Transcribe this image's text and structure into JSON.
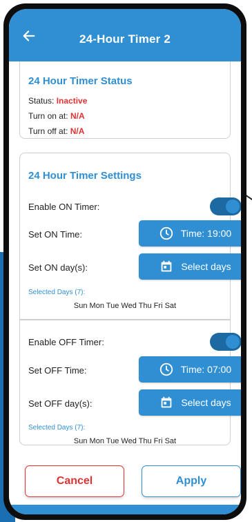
{
  "appbar": {
    "title": "24-Hour Timer 2",
    "back_icon": "arrow-left-icon"
  },
  "status": {
    "title": "24 Hour Timer Status",
    "status_label": "Status:",
    "status_value": "Inactive",
    "on_label": "Turn on at:",
    "on_value": "N/A",
    "off_label": "Turn off at:",
    "off_value": "N/A",
    "value_color": "#e03232"
  },
  "settings": {
    "title": "24 Hour Timer Settings",
    "on": {
      "enable_label": "Enable ON Timer:",
      "enabled": true,
      "time_label": "Set ON Time:",
      "time_button": "Time: 19:00",
      "days_label": "Set ON day(s):",
      "days_button": "Select days",
      "selected_label": "Selected Days (7):",
      "selected_days": "Sun Mon Tue Wed Thu Fri Sat"
    },
    "off": {
      "enable_label": "Enable OFF Timer:",
      "enabled": true,
      "time_label": "Set OFF Time:",
      "time_button": "Time: 07:00",
      "days_label": "Set OFF day(s):",
      "days_button": "Select days",
      "selected_label": "Selected Days (7):",
      "selected_days": "Sun Mon Tue Wed Thu Fri Sat"
    }
  },
  "actions": {
    "cancel": "Cancel",
    "apply": "Apply"
  },
  "colors": {
    "accent": "#2f8fd2",
    "toggle_track": "#1d6aa3",
    "danger": "#e03232"
  },
  "icons": {
    "time": "clock-icon",
    "days": "calendar-icon"
  }
}
